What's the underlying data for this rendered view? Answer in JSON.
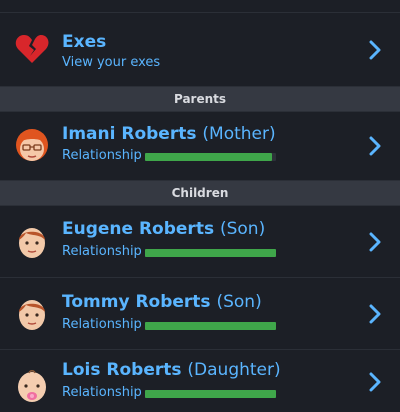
{
  "exes": {
    "title": "Exes",
    "subtitle": "View your exes",
    "icon": "broken-heart-icon"
  },
  "sections": {
    "parents": "Parents",
    "children": "Children"
  },
  "relationship_label": "Relationship",
  "people": [
    {
      "name": "Imani Roberts",
      "relation": "(Mother)",
      "relationship_level": 0.97,
      "avatar": "mother-avatar-icon"
    },
    {
      "name": "Eugene Roberts",
      "relation": "(Son)",
      "relationship_level": 1.0,
      "avatar": "son-avatar-icon"
    },
    {
      "name": "Tommy Roberts",
      "relation": "(Son)",
      "relationship_level": 1.0,
      "avatar": "son-avatar-icon"
    },
    {
      "name": "Lois Roberts",
      "relation": "(Daughter)",
      "relationship_level": 1.0,
      "avatar": "baby-daughter-avatar-icon"
    }
  ],
  "colors": {
    "accent": "#5ab5ff",
    "bar": "#3fa64a",
    "background": "#1c1f26",
    "section_header": "#353942"
  }
}
